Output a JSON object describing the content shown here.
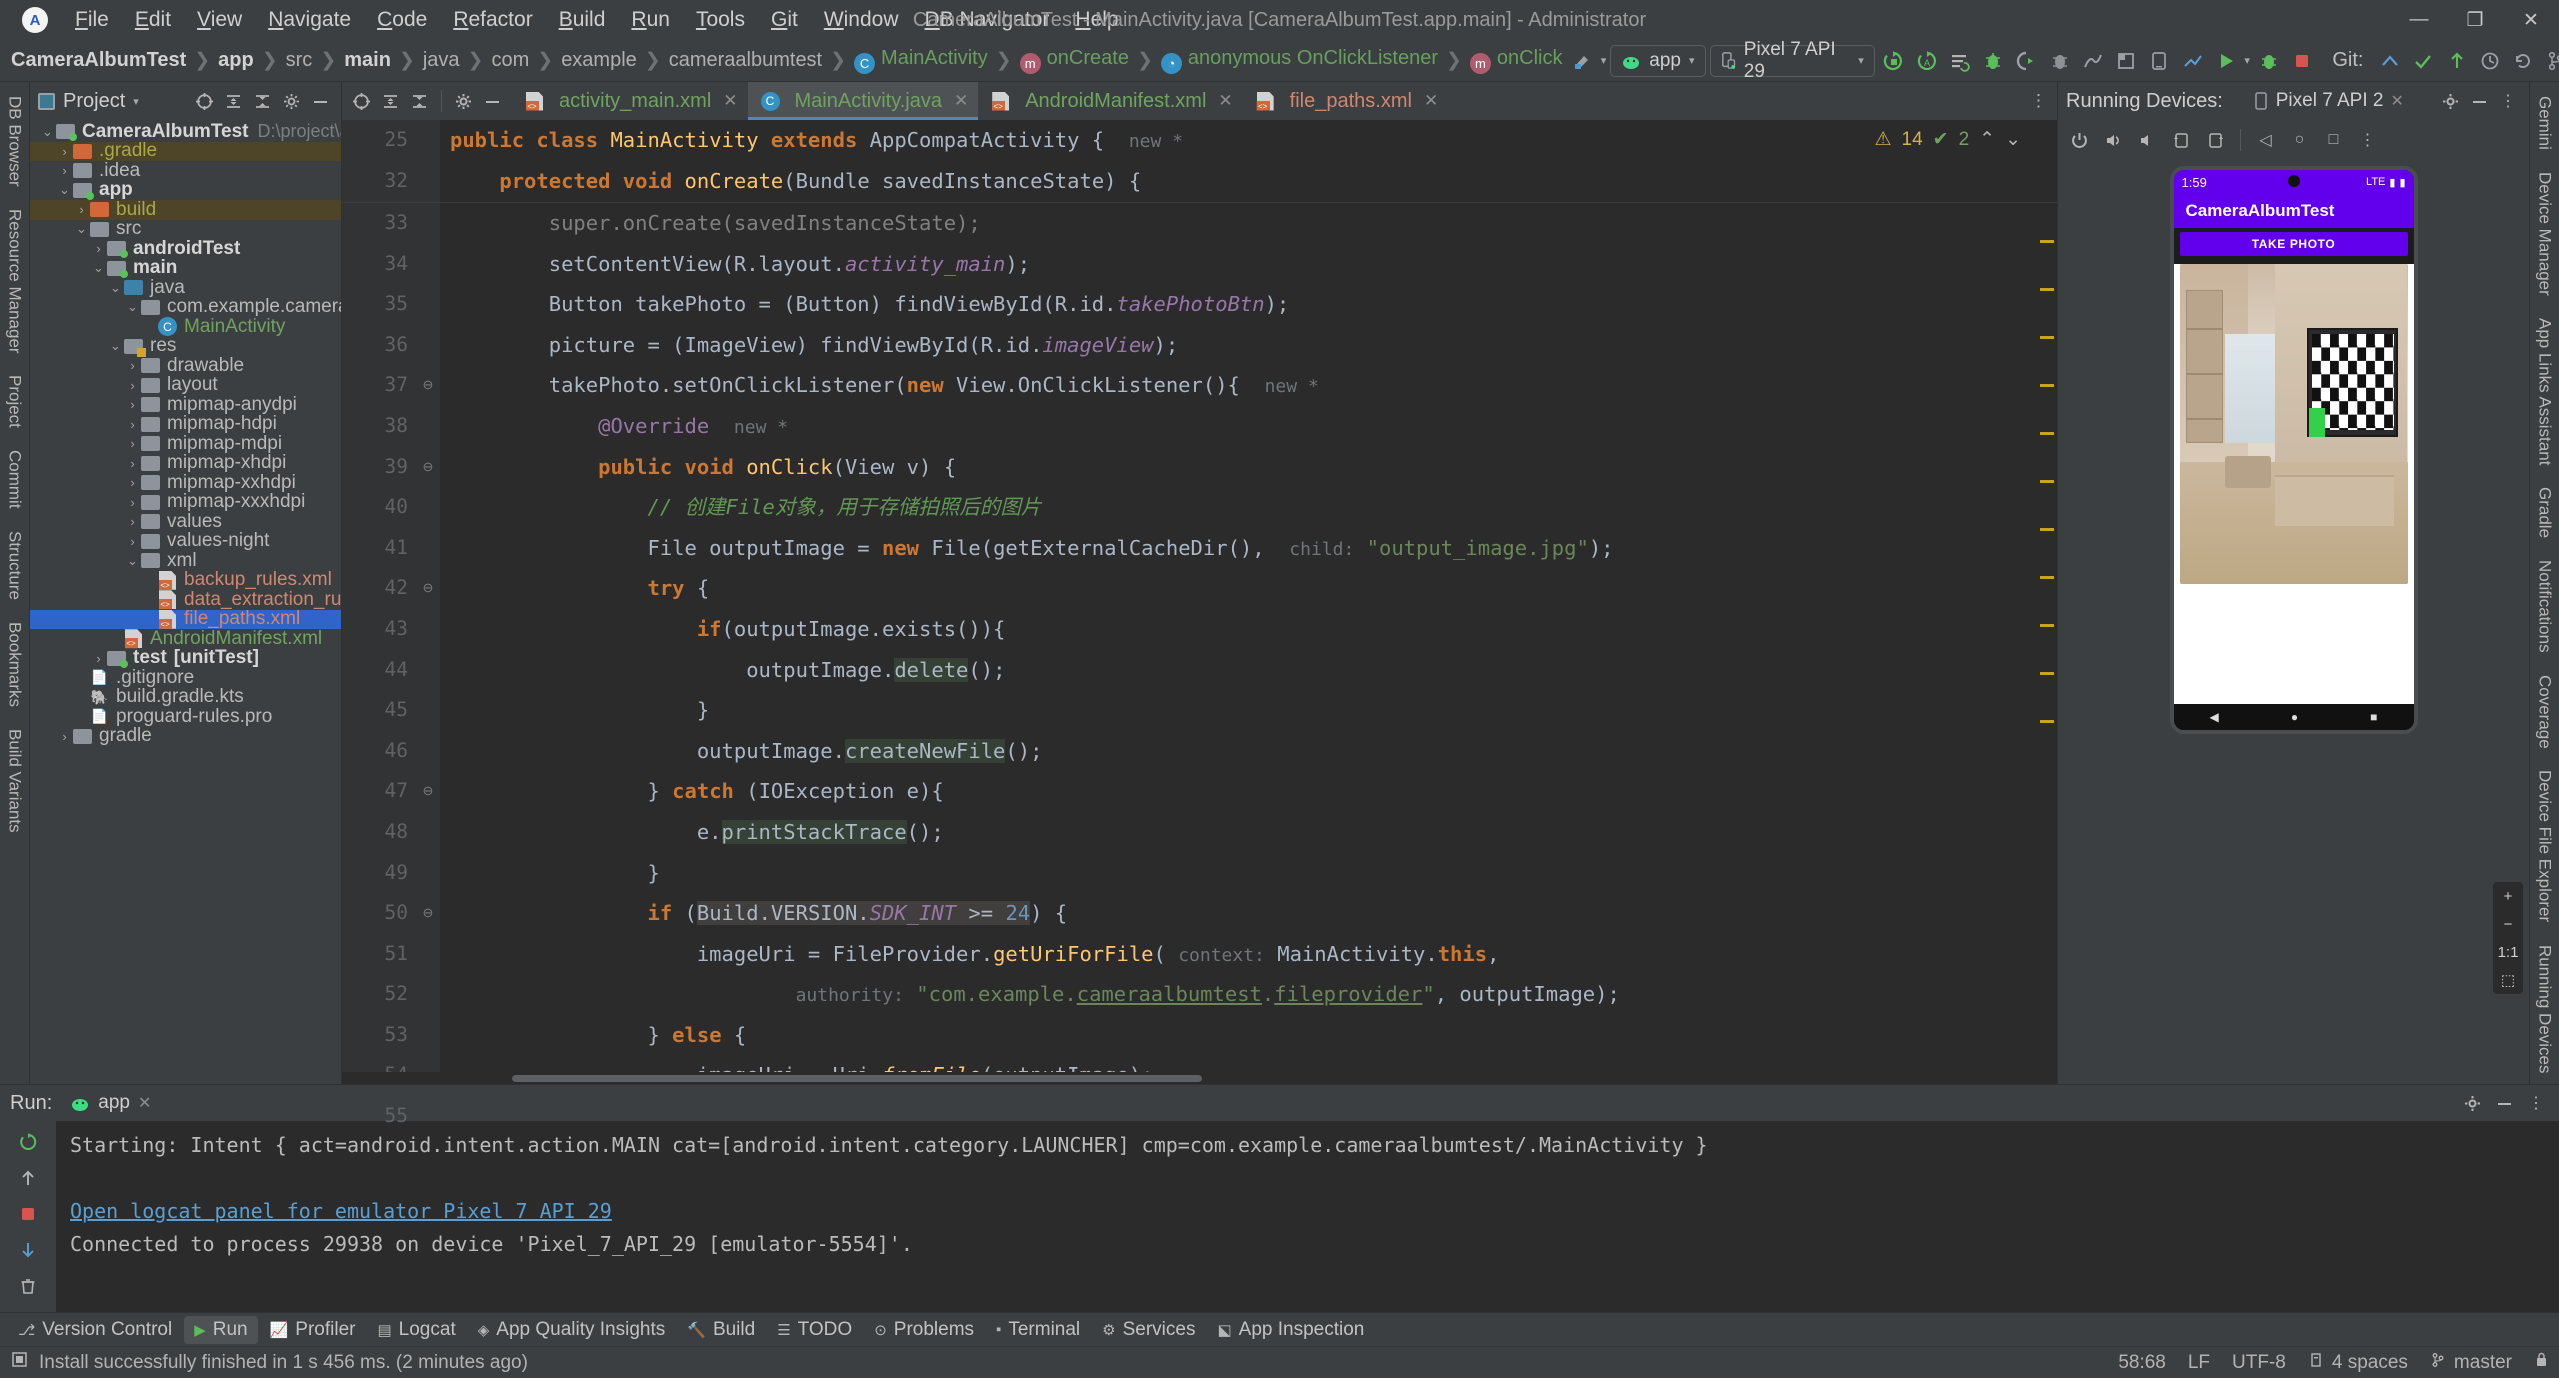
{
  "window": {
    "title": "CameraAlbumTest - MainActivity.java [CameraAlbumTest.app.main] - Administrator",
    "minimize": "—",
    "maximize": "❐",
    "close": "✕"
  },
  "menu": [
    "File",
    "Edit",
    "View",
    "Navigate",
    "Code",
    "Refactor",
    "Build",
    "Run",
    "Tools",
    "Git",
    "Window",
    "DB Navigator",
    "Help"
  ],
  "breadcrumbs": [
    {
      "label": "CameraAlbumTest",
      "bold": true,
      "icon": ""
    },
    {
      "label": "app",
      "bold": true,
      "icon": ""
    },
    {
      "label": "src",
      "bold": false,
      "icon": ""
    },
    {
      "label": "main",
      "bold": true,
      "icon": ""
    },
    {
      "label": "java",
      "bold": false,
      "icon": ""
    },
    {
      "label": "com",
      "bold": false,
      "icon": ""
    },
    {
      "label": "example",
      "bold": false,
      "icon": ""
    },
    {
      "label": "cameraalbumtest",
      "bold": false,
      "icon": ""
    },
    {
      "label": "MainActivity",
      "bold": false,
      "icon": "class-icon",
      "iconLetter": "C",
      "green": true
    },
    {
      "label": "onCreate",
      "bold": false,
      "icon": "method-icon",
      "iconLetter": "m",
      "green": true
    },
    {
      "label": "anonymous OnClickListener",
      "bold": false,
      "icon": "anonymous-class-icon",
      "iconLetter": "◔",
      "green": true
    },
    {
      "label": "onClick",
      "bold": false,
      "icon": "method-icon",
      "iconLetter": "m",
      "green": true
    }
  ],
  "toolbar": {
    "app_config": "app",
    "device": "Pixel 7 API 29",
    "git_label": "Git:",
    "icons": [
      "run-icon",
      "debug-icon",
      "profile-icon",
      "apply-changes-icon",
      "attach-debugger-icon",
      "search-everywhere-icon",
      "settings-icon",
      "account-icon",
      "notifications-icon"
    ]
  },
  "project_panel": {
    "title": "Project",
    "actions": [
      "expand-icon",
      "collapse-icon",
      "sort-icon",
      "settings-icon",
      "hide-icon"
    ],
    "tree": [
      {
        "indent": 0,
        "arrow": "⌄",
        "icon": "module-folder",
        "iconClass": "grey mod",
        "label": "CameraAlbumTest",
        "bold": true,
        "path": "D:\\project\\android-project\\Cam",
        "hl": ""
      },
      {
        "indent": 1,
        "arrow": "›",
        "icon": "folder-excluded",
        "iconClass": "orange",
        "label": ".gradle",
        "labelClass": "olive",
        "hl": "gold"
      },
      {
        "indent": 1,
        "arrow": "›",
        "icon": "folder",
        "iconClass": "grey",
        "label": ".idea",
        "hl": ""
      },
      {
        "indent": 1,
        "arrow": "⌄",
        "icon": "module-folder",
        "iconClass": "grey mod",
        "label": "app",
        "bold": true,
        "hl": ""
      },
      {
        "indent": 2,
        "arrow": "›",
        "icon": "folder-excluded",
        "iconClass": "orange",
        "label": "build",
        "labelClass": "olive",
        "hl": "gold"
      },
      {
        "indent": 2,
        "arrow": "⌄",
        "icon": "folder",
        "iconClass": "grey",
        "label": "src",
        "hl": ""
      },
      {
        "indent": 3,
        "arrow": "›",
        "icon": "module-folder",
        "iconClass": "grey mod",
        "label": "androidTest",
        "bold": true,
        "hl": ""
      },
      {
        "indent": 3,
        "arrow": "⌄",
        "icon": "module-folder",
        "iconClass": "grey mod",
        "label": "main",
        "bold": true,
        "hl": ""
      },
      {
        "indent": 4,
        "arrow": "⌄",
        "icon": "source-folder",
        "iconClass": "blue",
        "label": "java",
        "hl": ""
      },
      {
        "indent": 5,
        "arrow": "⌄",
        "icon": "package-folder",
        "iconClass": "grey",
        "label": "com.example.cameraalbumtest",
        "hl": ""
      },
      {
        "indent": 6,
        "arrow": "",
        "icon": "class-icon",
        "iconClass": "cls",
        "label": "MainActivity",
        "labelClass": "green",
        "hl": ""
      },
      {
        "indent": 4,
        "arrow": "⌄",
        "icon": "res-folder",
        "iconClass": "grey res",
        "label": "res",
        "hl": ""
      },
      {
        "indent": 5,
        "arrow": "›",
        "icon": "folder",
        "iconClass": "grey",
        "label": "drawable",
        "hl": ""
      },
      {
        "indent": 5,
        "arrow": "›",
        "icon": "folder",
        "iconClass": "grey",
        "label": "layout",
        "hl": ""
      },
      {
        "indent": 5,
        "arrow": "›",
        "icon": "folder",
        "iconClass": "grey",
        "label": "mipmap-anydpi",
        "hl": ""
      },
      {
        "indent": 5,
        "arrow": "›",
        "icon": "folder",
        "iconClass": "grey",
        "label": "mipmap-hdpi",
        "hl": ""
      },
      {
        "indent": 5,
        "arrow": "›",
        "icon": "folder",
        "iconClass": "grey",
        "label": "mipmap-mdpi",
        "hl": ""
      },
      {
        "indent": 5,
        "arrow": "›",
        "icon": "folder",
        "iconClass": "grey",
        "label": "mipmap-xhdpi",
        "hl": ""
      },
      {
        "indent": 5,
        "arrow": "›",
        "icon": "folder",
        "iconClass": "grey",
        "label": "mipmap-xxhdpi",
        "hl": ""
      },
      {
        "indent": 5,
        "arrow": "›",
        "icon": "folder",
        "iconClass": "grey",
        "label": "mipmap-xxxhdpi",
        "hl": ""
      },
      {
        "indent": 5,
        "arrow": "›",
        "icon": "folder",
        "iconClass": "grey",
        "label": "values",
        "hl": ""
      },
      {
        "indent": 5,
        "arrow": "›",
        "icon": "folder",
        "iconClass": "grey",
        "label": "values-night",
        "hl": ""
      },
      {
        "indent": 5,
        "arrow": "⌄",
        "icon": "folder",
        "iconClass": "grey",
        "label": "xml",
        "hl": ""
      },
      {
        "indent": 6,
        "arrow": "",
        "icon": "xml-icon",
        "label": "backup_rules.xml",
        "labelClass": "orange",
        "hl": ""
      },
      {
        "indent": 6,
        "arrow": "",
        "icon": "xml-icon",
        "label": "data_extraction_rules.xml",
        "labelClass": "orange",
        "hl": ""
      },
      {
        "indent": 6,
        "arrow": "",
        "icon": "xml-icon",
        "label": "file_paths.xml",
        "labelClass": "orange",
        "hl": "blue"
      },
      {
        "indent": 4,
        "arrow": "",
        "icon": "xml-icon",
        "label": "AndroidManifest.xml",
        "labelClass": "green",
        "hl": ""
      },
      {
        "indent": 3,
        "arrow": "›",
        "icon": "test-folder",
        "iconClass": "grey mod",
        "label": "test",
        "bold": true,
        "suffix": "[unitTest]",
        "hl": ""
      },
      {
        "indent": 2,
        "arrow": "",
        "icon": "gitignore-icon",
        "label": ".gitignore",
        "hl": ""
      },
      {
        "indent": 2,
        "arrow": "",
        "icon": "gradle-icon",
        "label": "build.gradle.kts",
        "hl": ""
      },
      {
        "indent": 2,
        "arrow": "",
        "icon": "file-icon",
        "label": "proguard-rules.pro",
        "hl": ""
      },
      {
        "indent": 1,
        "arrow": "›",
        "icon": "folder",
        "iconClass": "grey",
        "label": "gradle",
        "hl": ""
      }
    ]
  },
  "editor": {
    "tools": [
      "target-icon",
      "expand-all-icon",
      "collapse-all-icon",
      "settings-icon",
      "hide-icon"
    ],
    "tabs": [
      {
        "label": "activity_main.xml",
        "icon": "xml-icon",
        "color": "green",
        "active": false
      },
      {
        "label": "MainActivity.java",
        "icon": "class-icon",
        "color": "green",
        "active": true
      },
      {
        "label": "AndroidManifest.xml",
        "icon": "xml-icon",
        "color": "green",
        "active": false
      },
      {
        "label": "file_paths.xml",
        "icon": "xml-icon",
        "color": "orange",
        "active": false
      }
    ],
    "inspections": {
      "warnings": "14",
      "errors": "2",
      "warn_icon": "⚠",
      "err_icon": "✔"
    },
    "sticky_lines": [
      {
        "num": "25",
        "html": "<span class=\"k\">public class</span> <span class=\"t\">MainActivity</span> <span class=\"k\">extends</span> AppCompatActivity {  <span class=\"hint\">new *</span>"
      },
      {
        "num": "32",
        "html": "    <span class=\"k\">protected void</span> <span class=\"t\">onCreate</span>(Bundle savedInstanceState) {"
      }
    ],
    "lines": [
      {
        "num": "33",
        "fold": "",
        "html": "        <span class=\"c\">super</span>.onCreate(savedInstanceState);",
        "dim": true
      },
      {
        "num": "34",
        "fold": "",
        "html": "        setContentView(R.layout.<span class=\"f it\">activity_main</span>);"
      },
      {
        "num": "35",
        "fold": "",
        "html": "        Button takePhoto = (Button) findViewById(R.id.<span class=\"f it\">takePhotoBtn</span>);"
      },
      {
        "num": "36",
        "fold": "",
        "html": "        picture = (ImageView) findViewById(R.id.<span class=\"f it\">imageView</span>);"
      },
      {
        "num": "37",
        "fold": "⊖",
        "html": "        takePhoto.setOnClickListener(<span class=\"k\">new</span> View.OnClickListener(){  <span class=\"hint\">new *</span>"
      },
      {
        "num": "38",
        "fold": "",
        "html": "            <span class=\"f\">@Override</span>  <span class=\"hint\">new *</span>"
      },
      {
        "num": "39",
        "fold": "⊖",
        "html": "            <span class=\"k\">public void</span> <span class=\"t\">onClick</span>(View v) {",
        "mark": "↑"
      },
      {
        "num": "40",
        "fold": "",
        "html": "                <span class=\"cm\">// 创建File对象，用于存储拍照后的图片</span>"
      },
      {
        "num": "41",
        "fold": "",
        "html": "                File outputImage = <span class=\"k\">new</span> File(getExternalCacheDir(),  <span class=\"hint\">child:</span> <span class=\"s\">\"output_image.jpg\"</span>);"
      },
      {
        "num": "42",
        "fold": "⊖",
        "html": "                <span class=\"k\">try</span> {"
      },
      {
        "num": "43",
        "fold": "",
        "html": "                    <span class=\"k\">if</span>(outputImage.exists()){"
      },
      {
        "num": "44",
        "fold": "",
        "html": "                        outputImage.<span class=\"hl\">delete</span>();"
      },
      {
        "num": "45",
        "fold": "",
        "html": "                    }"
      },
      {
        "num": "46",
        "fold": "",
        "html": "                    outputImage.<span class=\"hl\">createNewFile</span>();"
      },
      {
        "num": "47",
        "fold": "⊖",
        "html": "                } <span class=\"k\">catch</span> (IOException e){"
      },
      {
        "num": "48",
        "fold": "",
        "html": "                    e.<span class=\"hl\">printStackTrace</span>();"
      },
      {
        "num": "49",
        "fold": "",
        "html": "                }"
      },
      {
        "num": "50",
        "fold": "⊖",
        "html": "                <span class=\"k\">if</span> (<span class=\"hl2\">Build.VERSION.<span class=\"f it\">SDK_INT</span> &gt;= <span class=\"n\">24</span></span>) {"
      },
      {
        "num": "51",
        "fold": "",
        "html": "                    imageUri = FileProvider.<span class=\"t\">getUriForFile</span>( <span class=\"hint\">context:</span> MainActivity.<span class=\"k\">this</span>,"
      },
      {
        "num": "52",
        "fold": "",
        "html": "                            <span class=\"hint\">authority:</span> <span class=\"s\">\"com.example.<u>cameraalbumtest</u>.<u>fileprovider</u>\"</span>, outputImage);"
      },
      {
        "num": "53",
        "fold": "",
        "html": "                } <span class=\"k\">else</span> {"
      },
      {
        "num": "54",
        "fold": "",
        "html": "                    imageUri = Uri.<span class=\"t it\">fromFile</span>(outputImage);"
      },
      {
        "num": "55",
        "fold": "",
        "html": "                }",
        "partial": true
      }
    ]
  },
  "devices": {
    "title": "Running Devices:",
    "tab_label": "Pixel 7 API 2",
    "toolbar_icons": [
      "power-icon",
      "volume-up-icon",
      "volume-down-icon",
      "rotate-left-icon",
      "rotate-right-icon",
      "back-icon",
      "home-icon",
      "overview-icon",
      "screenshot-icon",
      "record-icon",
      "more-icon"
    ],
    "phone": {
      "clock": "1:59",
      "network": "LTE",
      "app_title": "CameraAlbumTest",
      "button_label": "TAKE PHOTO",
      "nav": [
        "back-triangle",
        "home-circle",
        "recents-square"
      ]
    },
    "zoom_controls": {
      "plus": "+",
      "minus": "−",
      "fit": "1:1",
      "actual": "⬚"
    }
  },
  "run_panel": {
    "label": "Run:",
    "tab": "app",
    "console": [
      {
        "text": "Starting: Intent { act=android.intent.action.MAIN cat=[android.intent.category.LAUNCHER] cmp=com.example.cameraalbumtest/.MainActivity }",
        "link": false
      },
      {
        "text": "",
        "link": false
      },
      {
        "text": "Open logcat panel for emulator Pixel 7 API 29",
        "link": true
      },
      {
        "text": "Connected to process 29938 on device 'Pixel_7_API_29 [emulator-5554]'.",
        "link": false
      }
    ],
    "rail_icons": [
      "rerun-icon",
      "up-icon",
      "stop-icon",
      "down-icon",
      "trash-icon"
    ],
    "actions": [
      "settings-icon",
      "minimize-icon",
      "hide-icon"
    ]
  },
  "bottom_tools": [
    {
      "label": "Version Control",
      "icon": "vcs-icon",
      "active": false
    },
    {
      "label": "Run",
      "icon": "run-icon",
      "active": true
    },
    {
      "label": "Profiler",
      "icon": "profiler-icon",
      "active": false
    },
    {
      "label": "Logcat",
      "icon": "logcat-icon",
      "active": false
    },
    {
      "label": "App Quality Insights",
      "icon": "insights-icon",
      "active": false
    },
    {
      "label": "Build",
      "icon": "build-icon",
      "active": false
    },
    {
      "label": "TODO",
      "icon": "todo-icon",
      "active": false
    },
    {
      "label": "Problems",
      "icon": "problems-icon",
      "active": false
    },
    {
      "label": "Terminal",
      "icon": "terminal-icon",
      "active": false
    },
    {
      "label": "Services",
      "icon": "services-icon",
      "active": false
    },
    {
      "label": "App Inspection",
      "icon": "inspection-icon",
      "active": false
    }
  ],
  "status_bar": {
    "message": "Install successfully finished in 1 s 456 ms. (2 minutes ago)",
    "caret": "58:68",
    "line_sep": "LF",
    "encoding": "UTF-8",
    "indent": "4 spaces",
    "branch": "master"
  },
  "left_rail": [
    "DB Browser",
    "Resource Manager",
    "Project",
    "Commit",
    "Structure",
    "Bookmarks",
    "Build Variants"
  ],
  "right_rail": [
    "Gemini",
    "Device Manager",
    "App Links Assistant",
    "Gradle",
    "Notifications",
    "Coverage",
    "Device File Explorer",
    "Running Devices"
  ],
  "colors": {
    "accent": "#4a88c7",
    "panel": "#3c3f41",
    "editor": "#2b2b2b",
    "gutter": "#313335",
    "purple": "#6200ee",
    "green": "#6fa45f",
    "orange": "#d08770"
  }
}
